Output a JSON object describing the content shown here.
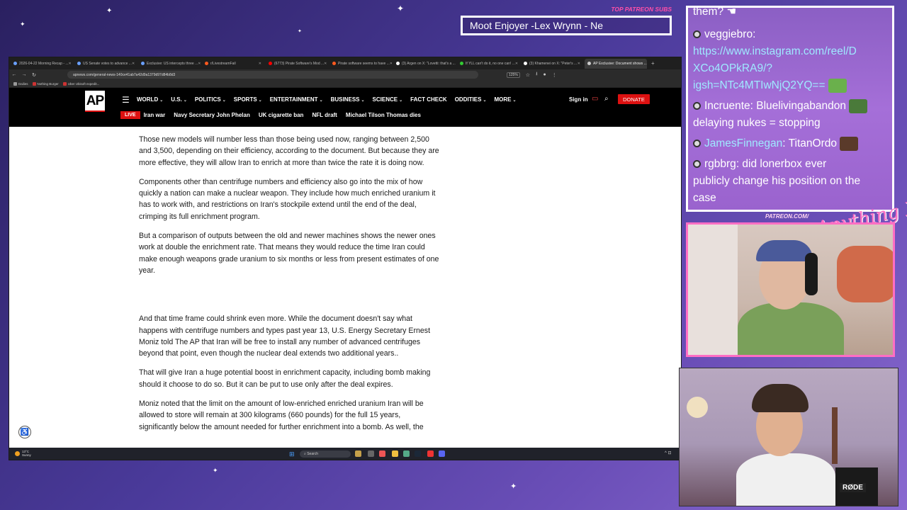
{
  "browser": {
    "tabs": [
      {
        "label": "2026-04-22 Morning Recap - ..."
      },
      {
        "label": "US Senate votes to advance ..."
      },
      {
        "label": "Exclusive: US intercepts three ..."
      },
      {
        "label": "r/LivestreamFail"
      },
      {
        "label": "(6773) Pirate Software's Mod ..."
      },
      {
        "label": "Pirate software seems to have ..."
      },
      {
        "label": "(3) Argen on X: \"Lovetti: that's a ..."
      },
      {
        "label": "If YLL can't do it, no one can! ..."
      },
      {
        "label": "(3) Khamenei on X: \"Peter's ..."
      },
      {
        "label": "AP Exclusive: Document shows ..."
      }
    ],
    "new_tab_glyph": "+",
    "url": "apnews.com/general-news-140ce41ab7a42d9a1379d97d84b8d3",
    "zoom": "125%",
    "bookmarks": [
      "Dailies",
      "Nothing Burger",
      "Uber Ubisoft expedit..."
    ]
  },
  "ap_site": {
    "logo": "AP",
    "menu": [
      {
        "label": "WORLD",
        "chevron": true
      },
      {
        "label": "U.S.",
        "chevron": true
      },
      {
        "label": "POLITICS",
        "chevron": true
      },
      {
        "label": "SPORTS",
        "chevron": true
      },
      {
        "label": "ENTERTAINMENT",
        "chevron": true
      },
      {
        "label": "BUSINESS",
        "chevron": true
      },
      {
        "label": "SCIENCE",
        "chevron": true
      },
      {
        "label": "FACT CHECK",
        "chevron": false
      },
      {
        "label": "ODDITIES",
        "chevron": true
      },
      {
        "label": "MORE",
        "chevron": true
      }
    ],
    "sign_in": "Sign in",
    "donate": "DONATE",
    "live_badge": "LIVE",
    "trending": [
      "Iran war",
      "Navy Secretary John Phelan",
      "UK cigarette ban",
      "NFL draft",
      "Michael Tilson Thomas dies"
    ]
  },
  "article": {
    "paragraphs": [
      "Those new models will number less than those being used now, ranging between 2,500 and 3,500, depending on their efficiency, according to the document. But because they are more effective, they will allow Iran to enrich at more than twice the rate it is doing now.",
      "Components other than centrifuge numbers and efficiency also go into the mix of how quickly a nation can make a nuclear weapon. They include how much enriched uranium it has to work with, and restrictions on Iran's stockpile extend until the end of the deal, crimping its full enrichment program.",
      "But a comparison of outputs between the old and newer machines shows the newer ones work at double the enrichment rate. That means they would reduce the time Iran could make enough weapons grade uranium to six months or less from present estimates of one year.",
      "And that time frame could shrink even more. While the document doesn't say what happens with centrifuge numbers and types past year 13, U.S. Energy Secretary Ernest Moniz told The AP that Iran will be free to install any number of advanced centrifuges beyond that point, even though the nuclear deal extends two additional years..",
      "That will give Iran a huge potential boost in enrichment capacity, including bomb making should it choose to do so. But it can be put to use only after the deal expires.",
      "Moniz noted that the limit on the amount of low-enriched enriched uranium Iran will be allowed to store will remain at 300 kilograms (660 pounds) for the full 15 years, significantly below the amount needed for further enrichment into a bomb. As well, the"
    ]
  },
  "taskbar": {
    "weather_temp": "13°C",
    "weather_desc": "Sunny",
    "search_placeholder": "Search"
  },
  "overlay": {
    "subs_label": "TOP PATREON SUBS",
    "subs_ticker": "Moot Enjoyer -Lex Wrynn -  Ne",
    "patreon_label": "PATREON.COM/",
    "logo_text": "Anything Else?"
  },
  "chat": {
    "first_line": "them? ",
    "messages": [
      {
        "user": "veggiebro",
        "sep": ":",
        "text": ""
      },
      {
        "link_line1": "https://www.instagram.com/reel/D",
        "link_line2": "XCo4OPkRA9/?",
        "link_line3": "igsh=NTc4MTIwNjQ2YQ=="
      },
      {
        "user": "Incruente",
        "sep": ":",
        "text": " Bluelivingabandon",
        "text2": "delaying nukes = stopping"
      },
      {
        "user": "JamesFinnegan",
        "sep": ":",
        "text": " TitanOrdo"
      },
      {
        "user": "rgbbrg",
        "sep": ":",
        "text": " did lonerbox ever",
        "text2": "publicly change his position on the",
        "text3": "case"
      }
    ]
  },
  "cam": {
    "mic_label": "RØDE"
  },
  "colors": {
    "ap_red": "#dd1111",
    "overlay_pink": "#ff6ec4",
    "chat_link": "#9fe9ff"
  }
}
